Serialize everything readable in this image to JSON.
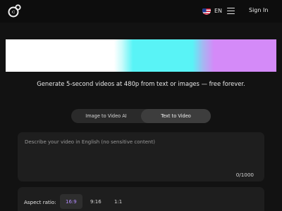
{
  "header": {
    "logo_icon": "film-reel-play-icon",
    "language": {
      "flag_icon": "us-flag-icon",
      "label": "EN"
    },
    "menu_icon": "hamburger-menu-icon",
    "signin_label": "Sign In"
  },
  "hero": {
    "tagline": "Generate 5-second videos at 480p from text or images — free forever."
  },
  "tabs": [
    {
      "label": "Image to Video AI",
      "active": false
    },
    {
      "label": "Text to Video",
      "active": true
    }
  ],
  "prompt": {
    "placeholder": "Describe your video in English (no sensitive content)",
    "value": "",
    "counter": "0/1000"
  },
  "aspect": {
    "label": "Aspect ratio:",
    "options": [
      {
        "label": "16:9",
        "selected": true
      },
      {
        "label": "9:16",
        "selected": false
      },
      {
        "label": "1:1",
        "selected": false
      }
    ]
  },
  "colors": {
    "background": "#121212",
    "card": "#1e1e1e",
    "accent_purple": "#b48cff",
    "banner_cyan": "#59f3f6",
    "banner_violet": "#d48af8"
  }
}
